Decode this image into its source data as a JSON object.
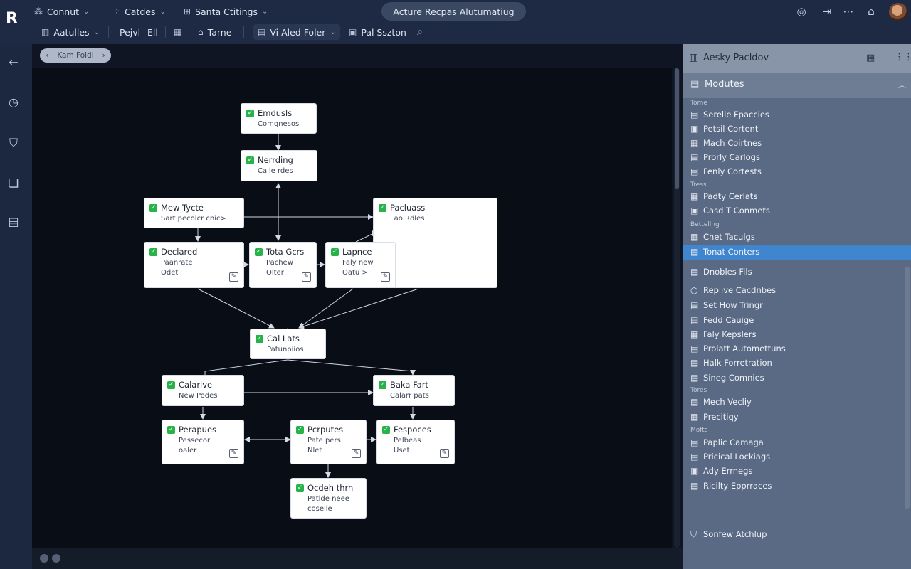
{
  "topbar": {
    "logo": "R",
    "menus": [
      {
        "icon": "connect-icon",
        "label": "Connut"
      },
      {
        "icon": "sparkle-icon",
        "label": "Catdes"
      },
      {
        "icon": "grid-icon",
        "label": "Santa Ctitings"
      }
    ],
    "title": "Acture Recpas Alutumatiug",
    "icons": [
      "globe-icon",
      "export-icon",
      "more-dots-icon",
      "bell-icon"
    ],
    "tools": [
      {
        "icon": "module-icon",
        "label": "Aatulles"
      },
      {
        "label": "Pejvl"
      },
      {
        "label": "Ell"
      },
      {
        "icon": "calendar-icon",
        "label": ""
      },
      {
        "icon": "home-icon",
        "label": "Tarne"
      },
      {
        "icon": "folder-icon",
        "label": "Vi Aled Foler"
      },
      {
        "icon": "table-icon",
        "label": "Pal Sszton"
      },
      {
        "icon": "search-icon",
        "label": ""
      }
    ]
  },
  "rail": [
    "arrow-left-icon",
    "clock-icon",
    "shield-icon",
    "layers-icon",
    "clipboard-icon"
  ],
  "canvas": {
    "breadcrumb": "Kam Foldl",
    "nodes": [
      {
        "id": "n1",
        "title": "Emdusls",
        "sub1": "Comgnesos",
        "sub2": ""
      },
      {
        "id": "n2",
        "title": "Nerrding",
        "sub1": "Calle rdes",
        "sub2": ""
      },
      {
        "id": "n3",
        "title": "Mew Tycte",
        "sub1": "Sart pecolcr cnic>",
        "sub2": ""
      },
      {
        "id": "n4",
        "title": "Pacluass",
        "sub1": "Lao Rdles",
        "sub2": ""
      },
      {
        "id": "n5",
        "title": "Declared",
        "sub1": "Paanrate",
        "sub2": "Odet"
      },
      {
        "id": "n6",
        "title": "Tota Gcrs",
        "sub1": "Pachew",
        "sub2": "Olter"
      },
      {
        "id": "n7",
        "title": "Lapnce",
        "sub1": "Faly new",
        "sub2": "Oatu >"
      },
      {
        "id": "n8",
        "title": "Cal Lats",
        "sub1": "Patunpiios",
        "sub2": ""
      },
      {
        "id": "n9",
        "title": "Calarive",
        "sub1": "New Podes",
        "sub2": ""
      },
      {
        "id": "n10",
        "title": "Baka Fart",
        "sub1": "Calarr pats",
        "sub2": ""
      },
      {
        "id": "n11",
        "title": "Perapues",
        "sub1": "Pessecor",
        "sub2": "oaler"
      },
      {
        "id": "n12",
        "title": "Pcrputes",
        "sub1": "Pate pers",
        "sub2": "Nlet"
      },
      {
        "id": "n13",
        "title": "Fespoces",
        "sub1": "Pelbeas",
        "sub2": "Uset"
      },
      {
        "id": "n14",
        "title": "Ocdeh thrn",
        "sub1": "Patlde neee",
        "sub2": "coselle"
      }
    ]
  },
  "panel": {
    "title": "Aesky Pacldov",
    "section": "Modutes",
    "groups": [
      {
        "label": "Tome",
        "items": [
          "Serelle Fpaccies",
          "Petsil Cortent",
          "Mach Coirtnes",
          "Prorly Carlogs",
          "Fenly Cortests"
        ]
      },
      {
        "label": "Tress",
        "items": [
          "Padty Cerlats",
          "Casd T Conmets"
        ]
      },
      {
        "label": "Bettellng",
        "items": [
          "Chet Taculgs",
          "Tonat Conters"
        ]
      },
      {
        "label": "",
        "items": [
          "Dnobles Fils"
        ]
      },
      {
        "label": "",
        "items": [
          "Replive Cacdnbes",
          "Set How Tringr",
          "Fedd Cauige",
          "Faly Kepslers",
          "Prolatt Automettuns",
          "Halk Forretration",
          "Sineg Comnies"
        ]
      },
      {
        "label": "Tores",
        "items": [
          "Mech Vecliy",
          "Precitiqy"
        ]
      },
      {
        "label": "Mofts",
        "items": [
          "Paplic Camaga",
          "Pricical Lockiags",
          "Ady Errnegs",
          "Ricilty Epprraces"
        ]
      }
    ],
    "selected": "Tonat Conters",
    "footer": "Sonfew Atchlup"
  }
}
